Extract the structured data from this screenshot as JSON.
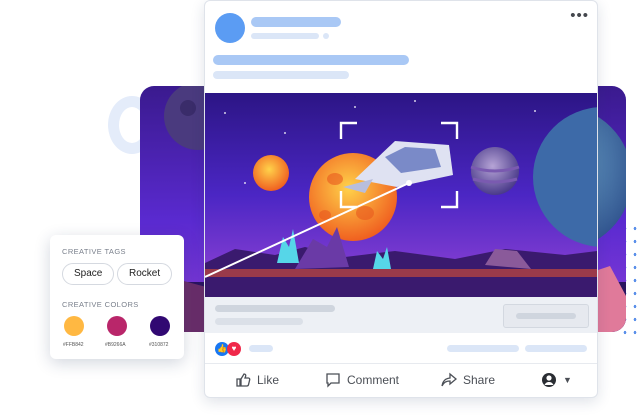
{
  "post": {
    "more_icon": "more-horizontal-icon",
    "actions": {
      "like": "Like",
      "comment": "Comment",
      "share": "Share"
    },
    "reactions": [
      "thumbs-up-icon",
      "heart-icon"
    ]
  },
  "creative_panel": {
    "tags_title": "CREATIVE TAGS",
    "tags": [
      "Space",
      "Rocket"
    ],
    "colors_title": "CREATIVE COLORS",
    "colors": [
      {
        "hex": "#FFB842",
        "label": "#FFB842"
      },
      {
        "hex": "#B9266A",
        "label": "#B9266A"
      },
      {
        "hex": "#310872",
        "label": "#310872"
      }
    ]
  },
  "theme": {
    "accent": "#5b9cf3",
    "skeleton": "#a9c8f5"
  }
}
